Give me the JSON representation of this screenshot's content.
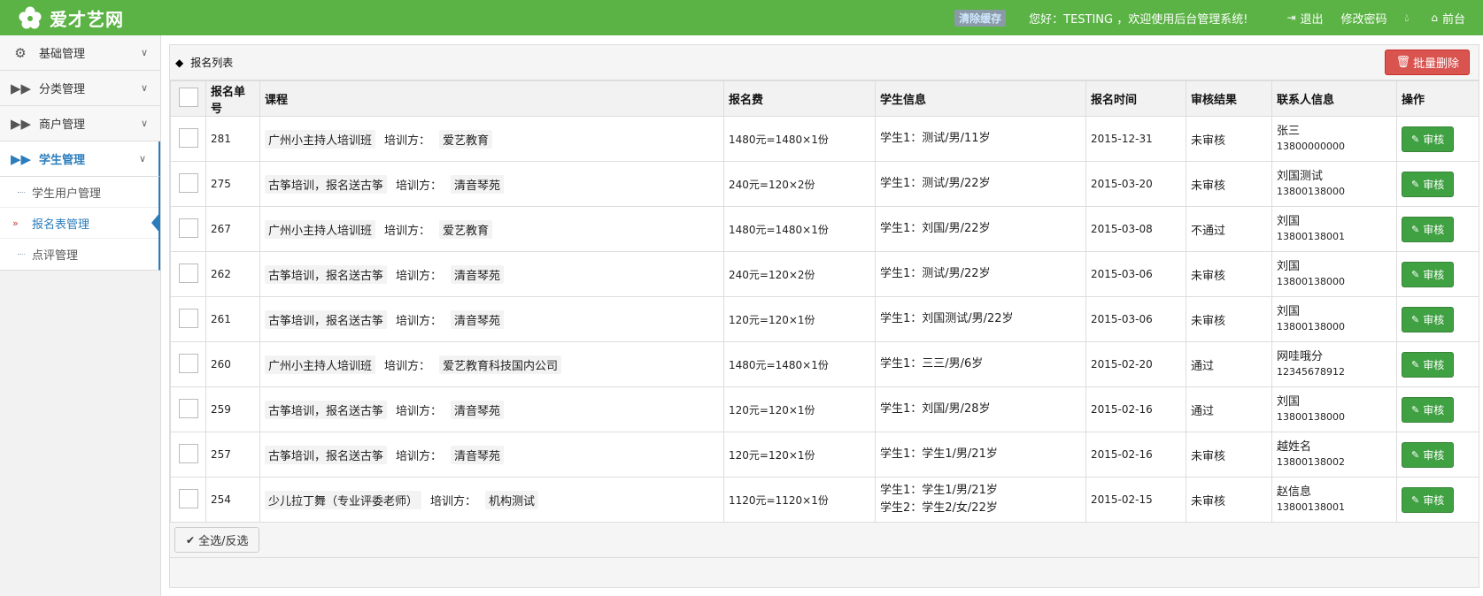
{
  "header": {
    "logo_text": "爱才艺网",
    "cache_label": "清除缓存",
    "welcome": "您好：TESTING ，欢迎使用后台管理系统!",
    "logout": "退出",
    "change_password": "修改密码",
    "frontend": "前台"
  },
  "sidebar": {
    "items": [
      {
        "label": "基础管理",
        "icon": "gears-icon"
      },
      {
        "label": "分类管理",
        "icon": "forward-icon"
      },
      {
        "label": "商户管理",
        "icon": "forward-icon"
      },
      {
        "label": "学生管理",
        "icon": "forward-icon"
      }
    ],
    "sub_items": [
      {
        "label": "学生用户管理"
      },
      {
        "label": "报名表管理"
      },
      {
        "label": "点评管理"
      }
    ]
  },
  "panel": {
    "title": "报名列表",
    "batch_delete": "批量删除",
    "select_all": "全选/反选"
  },
  "table": {
    "headers": [
      "报名单号",
      "课程",
      "报名费",
      "学生信息",
      "报名时间",
      "审核结果",
      "联系人信息",
      "操作"
    ],
    "trainer_label": "培训方：",
    "audit_label": "审核",
    "rows": [
      {
        "id": "281",
        "course": "广州小主持人培训班",
        "trainer": "爱艺教育",
        "fee": "1480元=1480×1份",
        "students": [
          "学生1：测试/男/11岁"
        ],
        "time": "2015-12-31",
        "result": "未审核",
        "contact_name": "张三",
        "contact_phone": "13800000000"
      },
      {
        "id": "275",
        "course": "古筝培训，报名送古筝",
        "trainer": "清音琴苑",
        "fee": "240元=120×2份",
        "students": [
          "学生1：测试/男/22岁"
        ],
        "time": "2015-03-20",
        "result": "未审核",
        "contact_name": "刘国测试",
        "contact_phone": "13800138000"
      },
      {
        "id": "267",
        "course": "广州小主持人培训班",
        "trainer": "爱艺教育",
        "fee": "1480元=1480×1份",
        "students": [
          "学生1：刘国/男/22岁"
        ],
        "time": "2015-03-08",
        "result": "不通过",
        "contact_name": "刘国",
        "contact_phone": "13800138001"
      },
      {
        "id": "262",
        "course": "古筝培训，报名送古筝",
        "trainer": "清音琴苑",
        "fee": "240元=120×2份",
        "students": [
          "学生1：测试/男/22岁"
        ],
        "time": "2015-03-06",
        "result": "未审核",
        "contact_name": "刘国",
        "contact_phone": "13800138000"
      },
      {
        "id": "261",
        "course": "古筝培训，报名送古筝",
        "trainer": "清音琴苑",
        "fee": "120元=120×1份",
        "students": [
          "学生1：刘国测试/男/22岁"
        ],
        "time": "2015-03-06",
        "result": "未审核",
        "contact_name": "刘国",
        "contact_phone": "13800138000"
      },
      {
        "id": "260",
        "course": "广州小主持人培训班",
        "trainer": "爱艺教育科技国内公司",
        "fee": "1480元=1480×1份",
        "students": [
          "学生1：三三/男/6岁"
        ],
        "time": "2015-02-20",
        "result": "通过",
        "contact_name": "网哇哦分",
        "contact_phone": "12345678912"
      },
      {
        "id": "259",
        "course": "古筝培训，报名送古筝",
        "trainer": "清音琴苑",
        "fee": "120元=120×1份",
        "students": [
          "学生1：刘国/男/28岁"
        ],
        "time": "2015-02-16",
        "result": "通过",
        "contact_name": "刘国",
        "contact_phone": "13800138000"
      },
      {
        "id": "257",
        "course": "古筝培训，报名送古筝",
        "trainer": "清音琴苑",
        "fee": "120元=120×1份",
        "students": [
          "学生1：学生1/男/21岁"
        ],
        "time": "2015-02-16",
        "result": "未审核",
        "contact_name": "越姓名",
        "contact_phone": "13800138002"
      },
      {
        "id": "254",
        "course": "少儿拉丁舞（专业评委老师）",
        "trainer": "机构测试",
        "fee": "1120元=1120×1份",
        "students": [
          "学生1：学生1/男/21岁",
          "学生2：学生2/女/22岁"
        ],
        "time": "2015-02-15",
        "result": "未审核",
        "contact_name": "赵信息",
        "contact_phone": "13800138001"
      }
    ]
  }
}
